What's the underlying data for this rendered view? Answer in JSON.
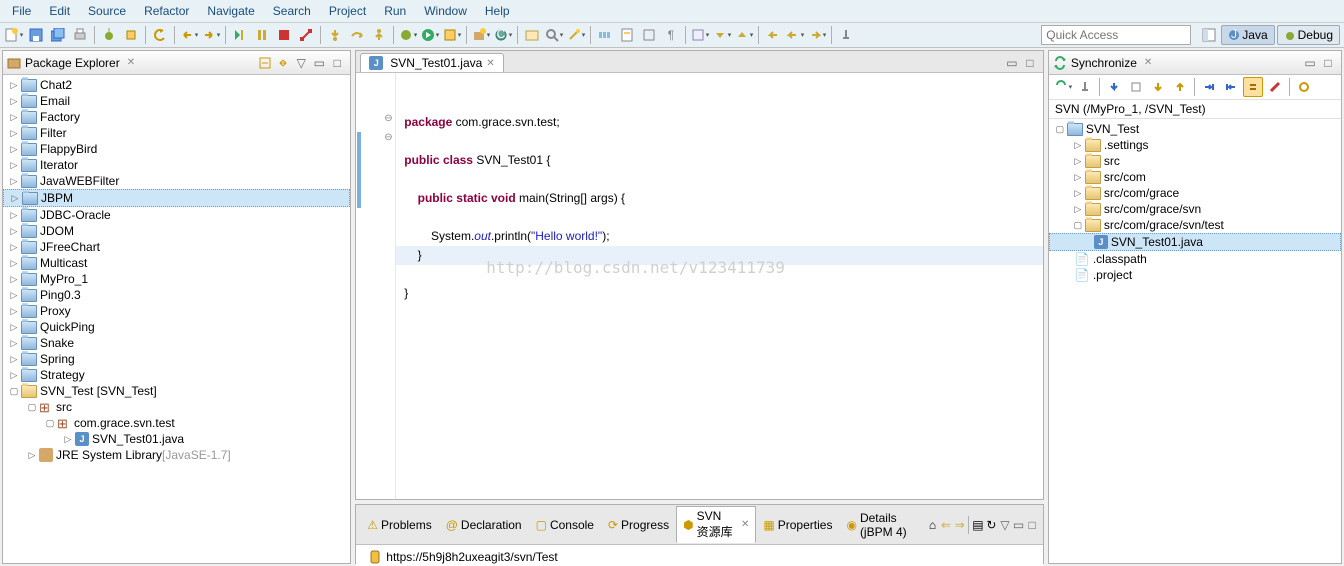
{
  "menu": [
    "File",
    "Edit",
    "Source",
    "Refactor",
    "Navigate",
    "Search",
    "Project",
    "Run",
    "Window",
    "Help"
  ],
  "quick_access_placeholder": "Quick Access",
  "perspectives": {
    "java": "Java",
    "debug": "Debug"
  },
  "package_explorer": {
    "title": "Package Explorer",
    "projects": [
      "Chat2",
      "Email",
      "Factory",
      "Filter",
      "FlappyBird",
      "Iterator",
      "JavaWEBFilter",
      "JBPM",
      "JDBC-Oracle",
      "JDOM",
      "JFreeChart",
      "Multicast",
      "MyPro_1",
      "Ping0.3",
      "Proxy",
      "QuickPing",
      "Snake",
      "Spring",
      "Strategy"
    ],
    "svn_project": {
      "label": "SVN_Test [SVN_Test]",
      "src": "src",
      "pkg": "com.grace.svn.test",
      "file": "SVN_Test01.java",
      "lib": "JRE System Library",
      "lib_suffix": "[JavaSE-1.7]"
    }
  },
  "editor": {
    "tab": "SVN_Test01.java",
    "code": {
      "l1a": "package",
      "l1b": " com.grace.svn.test;",
      "l2a": "public",
      "l2b": " class",
      "l2c": " SVN_Test01 {",
      "l3a": "public",
      "l3b": " static",
      "l3c": " void",
      "l3d": " main(String[] args) {",
      "l4a": "        System.",
      "l4b": "out",
      "l4c": ".println(",
      "l4d": "\"Hello world!\"",
      "l4e": ");",
      "l5": "    }",
      "l6": "}"
    },
    "watermark": "http://blog.csdn.net/v123411739"
  },
  "synchronize": {
    "title": "Synchronize",
    "root_label": "SVN (/MyPro_1, /SVN_Test)",
    "tree": {
      "proj": "SVN_Test",
      "items": [
        ".settings",
        "src",
        "src/com",
        "src/com/grace",
        "src/com/grace/svn"
      ],
      "expanded": "src/com/grace/svn/test",
      "file": "SVN_Test01.java",
      "extras": [
        ".classpath",
        ".project"
      ]
    }
  },
  "bottom": {
    "tabs": [
      "Problems",
      "Declaration",
      "Console",
      "Progress",
      "SVN 资源库",
      "Properties",
      "Details (jBPM 4)"
    ],
    "active": 4,
    "url": "https://5h9j8h2uxeagit3/svn/Test"
  }
}
